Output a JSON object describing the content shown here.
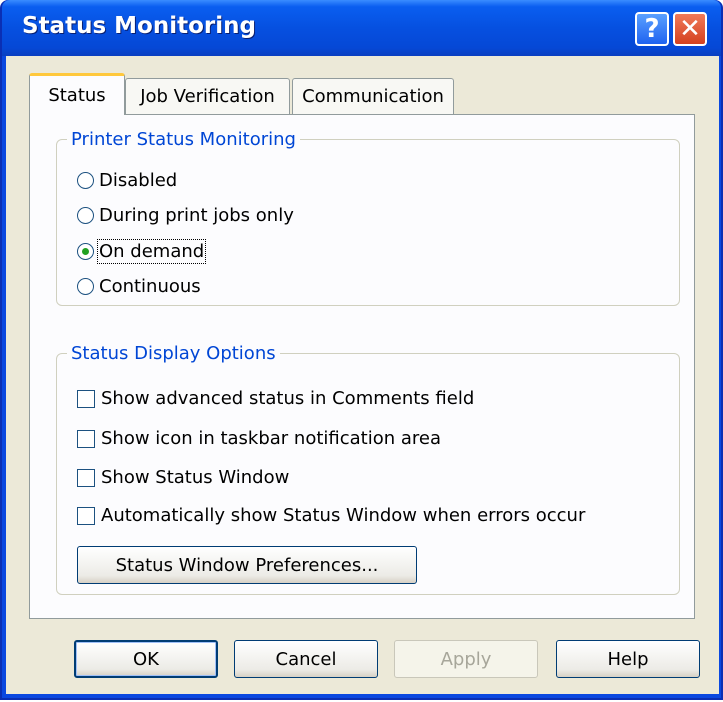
{
  "window": {
    "title": "Status Monitoring",
    "help_glyph": "?",
    "close_glyph": "✕"
  },
  "tabs": [
    {
      "label": "Status",
      "active": true
    },
    {
      "label": "Job Verification",
      "active": false
    },
    {
      "label": "Communication",
      "active": false
    }
  ],
  "printer_status": {
    "legend": "Printer Status Monitoring",
    "options": [
      {
        "label": "Disabled",
        "selected": false
      },
      {
        "label": "During print jobs only",
        "selected": false
      },
      {
        "label": "On demand",
        "selected": true
      },
      {
        "label": "Continuous",
        "selected": false
      }
    ]
  },
  "display_options": {
    "legend": "Status Display Options",
    "checks": [
      {
        "label": "Show advanced status in Comments field",
        "checked": false
      },
      {
        "label": "Show icon in taskbar notification area",
        "checked": false
      },
      {
        "label": "Show Status Window",
        "checked": false
      },
      {
        "label": "Automatically show Status Window when errors occur",
        "checked": false
      }
    ],
    "preferences_button": "Status Window Preferences..."
  },
  "footer": {
    "ok": "OK",
    "cancel": "Cancel",
    "apply": "Apply",
    "help": "Help"
  },
  "colors": {
    "title_bar": "#0650e0",
    "dialog_bg": "#ece9d8",
    "legend_text": "#0046d5",
    "active_tab_highlight": "#ffc83c"
  }
}
